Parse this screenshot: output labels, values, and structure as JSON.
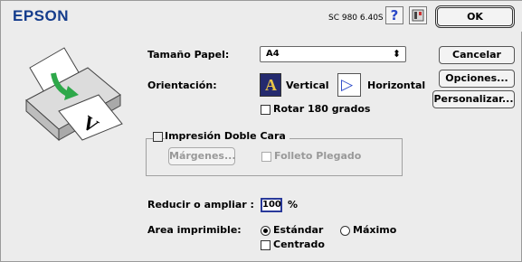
{
  "header": {
    "brand": "EPSON",
    "model": "SC 980 6.40S",
    "help_glyph": "?",
    "icons": [
      "help-icon",
      "utility-icon"
    ]
  },
  "buttons": {
    "ok": "OK",
    "cancel": "Cancelar",
    "options": "Opciones...",
    "customize": "Personalizar..."
  },
  "paper": {
    "label": "Tamaño Papel:",
    "value": "A4",
    "arrow": "⬍"
  },
  "orientation": {
    "label": "Orientación:",
    "vertical": "Vertical",
    "horizontal": "Horizontal",
    "vertical_glyph": "A",
    "horizontal_glyph": "▷",
    "rotate": "Rotar 180 grados",
    "selected": "vertical"
  },
  "duplex": {
    "label": "Impresión Doble Cara",
    "margins": "Márgenes...",
    "booklet": "Folleto Plegado"
  },
  "reduce": {
    "label": "Reducir o ampliar :",
    "value": "100",
    "unit": "%"
  },
  "printable": {
    "label": "Area imprimible:",
    "standard": "Estándar",
    "maximum": "Máximo",
    "centered": "Centrado",
    "selected": "standard"
  },
  "preview": {
    "paper_glyph": "V"
  },
  "colors": {
    "brand": "#143c8c",
    "arrow_green": "#2ea84a",
    "focus_border": "#2a3a9a"
  }
}
